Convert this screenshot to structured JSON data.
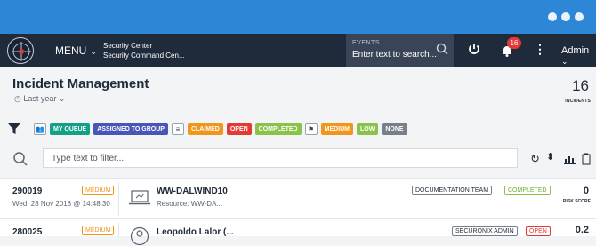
{
  "colors": {
    "topbar": "#2e87d6",
    "nav": "#1f2a3a",
    "teal": "#12a087",
    "indigo": "#4a55b8",
    "orange": "#f0961a",
    "red": "#e53935",
    "green": "#8bc34a",
    "gray": "#777f88"
  },
  "nav": {
    "menu_label": "MENU",
    "app_name": "Security Center",
    "app_sub": "Security Command Cen...",
    "search_label": "EVENTS",
    "search_placeholder": "Enter text to search...",
    "notifications_count": "16",
    "user_label": "Admin"
  },
  "header": {
    "title": "Incident Management",
    "period": "Last year",
    "count": "16",
    "count_label": "INCIDENTS"
  },
  "filters": {
    "my_queue": "MY QUEUE",
    "assigned_to_group": "ASSIGNED TO GROUP",
    "claimed": "CLAIMED",
    "open": "OPEN",
    "completed": "COMPLETED",
    "medium": "MEDIUM",
    "low": "LOW",
    "none": "NONE"
  },
  "filter_input": {
    "placeholder": "Type text to filter..."
  },
  "incidents": [
    {
      "id": "290019",
      "date": "Wed, 28 Nov 2018 @ 14:48:30",
      "severity": "MEDIUM",
      "name": "WW-DALWIND10",
      "resource": "Resource: WW-DA...",
      "group": "DOCUMENTATION TEAM",
      "status": "COMPLETED",
      "risk": "0",
      "risk_label": "RISK SCORE"
    },
    {
      "id": "280025",
      "severity": "MEDIUM",
      "name": "Leopoldo Lalor (...",
      "group": "SECURONIX ADMIN",
      "status": "OPEN",
      "risk": "0.2"
    }
  ]
}
